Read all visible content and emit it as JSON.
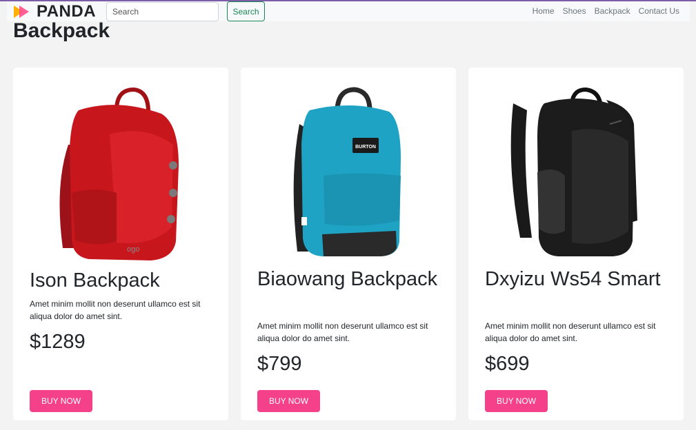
{
  "brand": {
    "name": "PANDA",
    "logo_icon": "panda-logo-icon"
  },
  "search": {
    "placeholder": "Search",
    "button_label": "Search"
  },
  "nav": {
    "links": [
      {
        "label": "Home"
      },
      {
        "label": "Shoes"
      },
      {
        "label": "Backpack"
      },
      {
        "label": "Contact Us"
      }
    ]
  },
  "page": {
    "title": "Backpack"
  },
  "products": [
    {
      "name": "Ison Backpack",
      "description": "Amet minim mollit non deserunt ullamco est sit aliqua dolor do amet sint.",
      "price": "$1289",
      "button_label": "BUY NOW",
      "image": "red-backpack-image",
      "color": "#c8161d"
    },
    {
      "name": "Biaowang Backpack",
      "description": "Amet minim mollit non deserunt ullamco est sit aliqua dolor do amet sint.",
      "price": "$799",
      "button_label": "BUY NOW",
      "image": "blue-backpack-image",
      "color": "#1ea3c4",
      "image_label": "BURTON"
    },
    {
      "name": "Dxyizu Ws54 Smart",
      "description": "Amet minim mollit non deserunt ullamco est sit aliqua dolor do amet sint.",
      "price": "$699",
      "button_label": "BUY NOW",
      "image": "black-backpack-image",
      "color": "#1c1c1c"
    }
  ],
  "colors": {
    "accent": "#f4418a",
    "search_button": "#198754",
    "topline": "#7b5ea7"
  }
}
